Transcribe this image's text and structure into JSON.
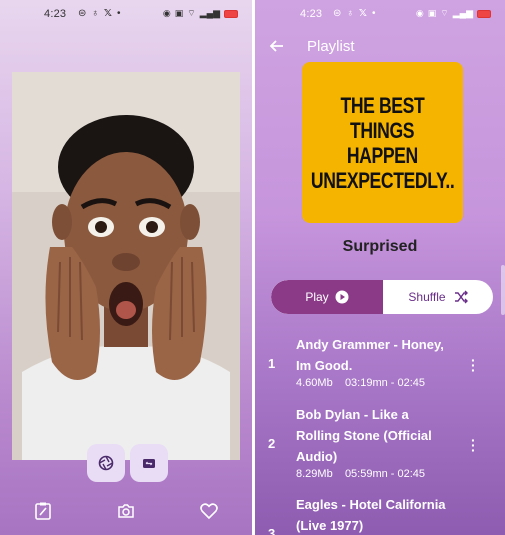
{
  "left_screen": {
    "status": {
      "time": "4:23"
    },
    "nav": {
      "edit": "edit-icon",
      "camera": "camera-icon",
      "favorite": "heart-icon"
    },
    "camera_buttons": {
      "capture": "aperture-icon",
      "switch": "switch-camera-icon"
    }
  },
  "right_screen": {
    "status": {
      "time": "4:23"
    },
    "header": {
      "title": "Playlist"
    },
    "cover_text": [
      "THE BEST",
      "THINGS",
      "HAPPEN",
      "UNEXPECTEDLY.."
    ],
    "album_name": "Surprised",
    "controls": {
      "play_label": "Play",
      "shuffle_label": "Shuffle"
    },
    "tracks": [
      {
        "num": "1",
        "title": "Andy Grammer - Honey, Im Good.",
        "size": "4.60Mb",
        "duration": "03:19mn - 02:45"
      },
      {
        "num": "2",
        "title": "Bob Dylan - Like a Rolling Stone (Official Audio)",
        "size": "8.29Mb",
        "duration": "05:59mn - 02:45"
      },
      {
        "num": "3",
        "title": "Eagles - Hotel California (Live 1977)"
      }
    ]
  }
}
